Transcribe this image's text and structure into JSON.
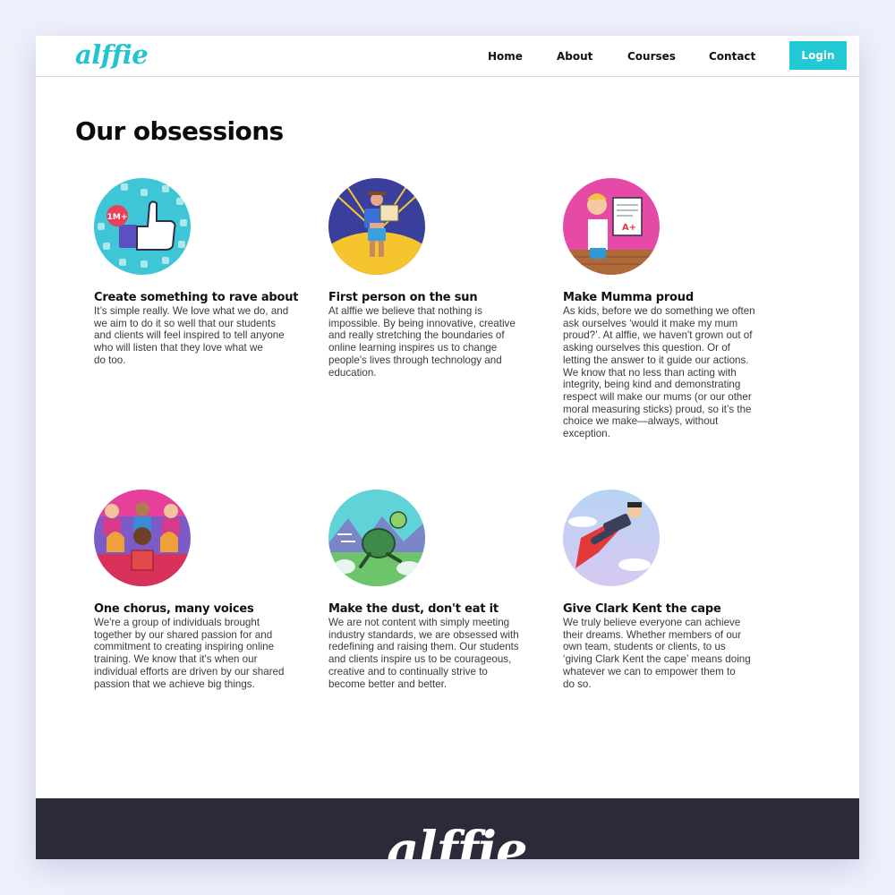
{
  "header": {
    "logo": "alffie",
    "nav": [
      "Home",
      "About",
      "Courses",
      "Contact"
    ],
    "login_label": "Login"
  },
  "main": {
    "title": "Our obsessions",
    "cards": [
      {
        "title": "Create something to rave about",
        "lines": [
          "It’s simple really. We love what we do, and",
          "we aim to do it so well that our students",
          "and clients will feel inspired to tell anyone",
          "who will listen that they love what we",
          "do too."
        ]
      },
      {
        "title": "First person on the sun",
        "lines": [
          "At alffie we believe that nothing is",
          "impossible. By being innovative, creative",
          "and really stretching the boundaries of",
          "online learning inspires us to change",
          "people's lives through technology and",
          "education."
        ]
      },
      {
        "title": "Make Mumma proud",
        "lines": [
          "As kids, before we do something we often",
          "ask ourselves ‘would it make my mum",
          "proud?’. At alffie, we haven't grown out of",
          "asking ourselves this question. Or of",
          "letting the answer to it guide our actions.",
          "We know that no less than acting with",
          "integrity, being kind and demonstrating",
          "respect will make our mums (or our other",
          "moral measuring sticks) proud, so it’s the",
          "choice we make—always, without",
          "exception."
        ]
      },
      {
        "title": "One chorus, many voices",
        "lines": [
          "We're a group of individuals brought",
          "together by our shared passion for and",
          "commitment to creating inspiring online",
          "training. We know that it's when our",
          "individual efforts are driven by our shared",
          "passion that we achieve big things."
        ]
      },
      {
        "title": "Make the dust, don't eat it",
        "lines": [
          "We are not content with simply meeting",
          "industry standards, we are obsessed with",
          "redefining and raising them. Our students",
          "and clients inspire us to be courageous,",
          "creative and to continually strive to",
          "become better and better."
        ]
      },
      {
        "title": "Give Clark Kent the cape",
        "lines": [
          "We truly believe everyone can achieve",
          "their dreams. Whether members of our",
          "own team, students or clients, to us",
          "‘giving Clark Kent the cape’ means doing",
          "whatever we can to empower them to",
          "do so."
        ]
      }
    ],
    "badge_text": "1M+",
    "grade_text": "A+"
  },
  "footer": {
    "logo": "alffie"
  },
  "colors": {
    "accent": "#22c9d4",
    "footer_bg": "#2b2a38",
    "text": "#3a3a3a"
  },
  "icons": [
    "thumbs-up-illustration",
    "explorer-illustration",
    "proud-kid-illustration",
    "choir-illustration",
    "running-turtle-illustration",
    "superhero-illustration"
  ]
}
